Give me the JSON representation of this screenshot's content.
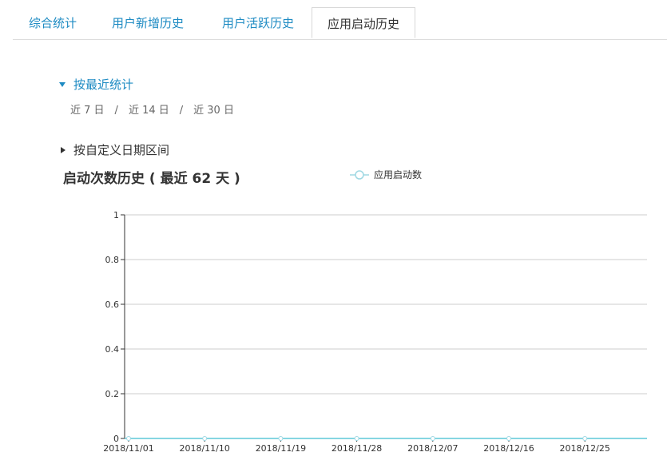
{
  "tabs": [
    {
      "label": "综合统计",
      "active": false
    },
    {
      "label": "用户新增历史",
      "active": false
    },
    {
      "label": "用户活跃历史",
      "active": false
    },
    {
      "label": "应用启动历史",
      "active": true
    }
  ],
  "recent": {
    "label": "按最近统计",
    "ranges": [
      "近 7 日",
      "近 14 日",
      "近 30 日"
    ],
    "separator": "/"
  },
  "custom_range": {
    "label": "按自定义日期区间"
  },
  "chart_title": "启动次数历史 ( 最近 62 天 )",
  "colors": {
    "accent": "#1e8bc3",
    "series": "#5ec8d8",
    "grid": "#cccccc"
  },
  "chart_data": {
    "type": "line",
    "title": "启动次数历史 ( 最近 62 天 )",
    "xlabel": "",
    "ylabel": "",
    "x_ticks": [
      "2018/11/01",
      "2018/11/10",
      "2018/11/19",
      "2018/11/28",
      "2018/12/07",
      "2018/12/16",
      "2018/12/25"
    ],
    "y_ticks": [
      0,
      0.2,
      0.4,
      0.6,
      0.8,
      1
    ],
    "ylim": [
      0,
      1
    ],
    "grid": true,
    "legend": "top",
    "series": [
      {
        "name": "应用启动数",
        "values": [
          0,
          0,
          0,
          0,
          0,
          0,
          0
        ]
      }
    ]
  }
}
